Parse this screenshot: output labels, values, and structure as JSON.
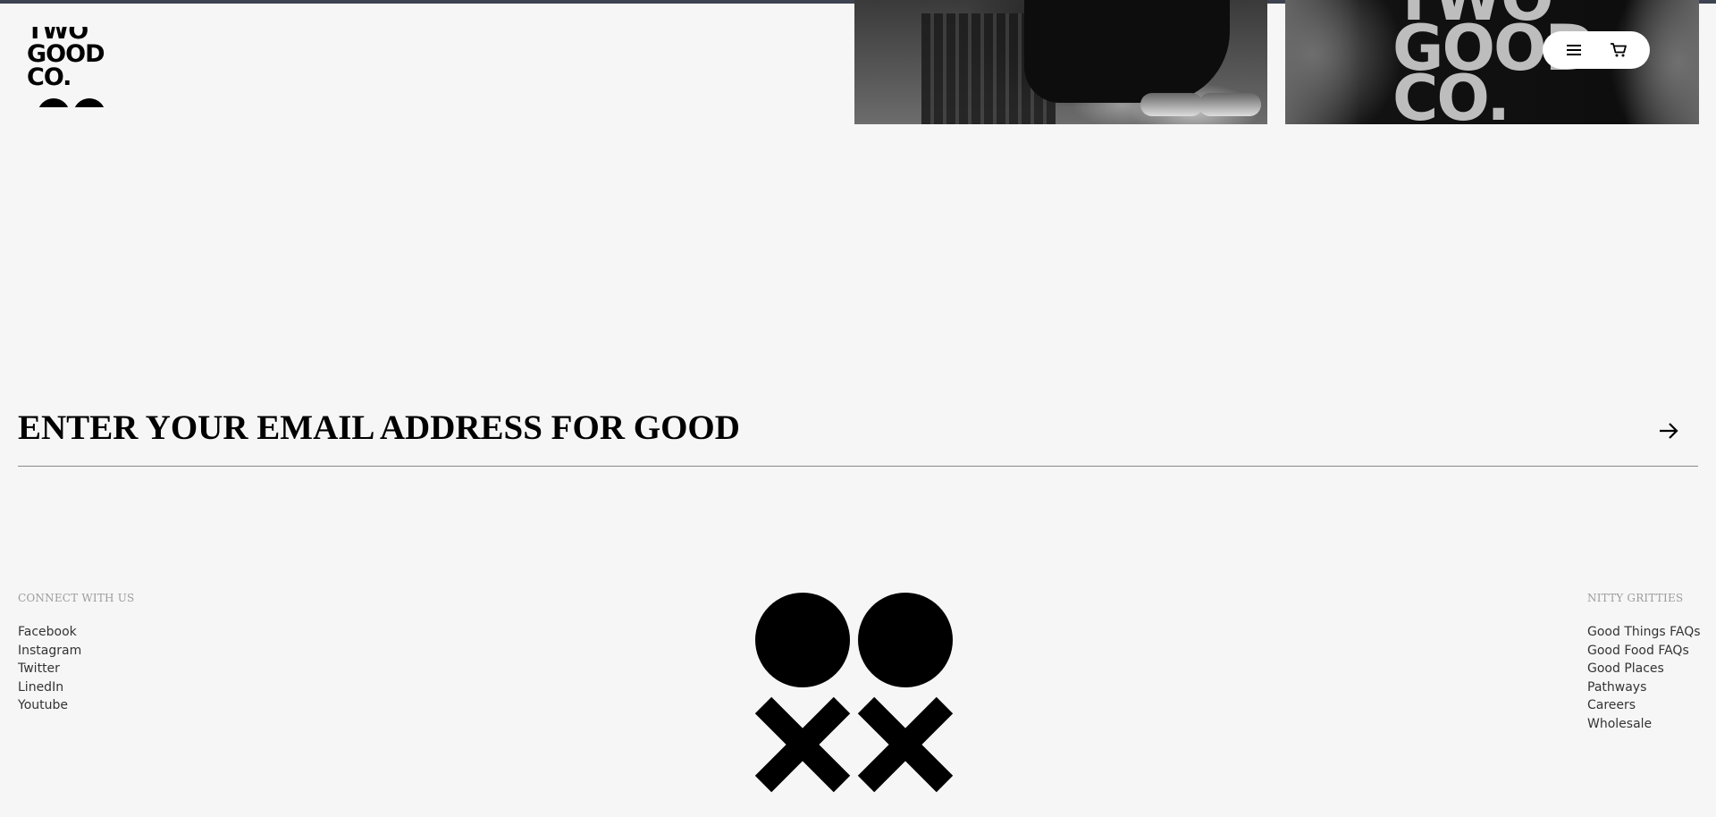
{
  "logo": {
    "line1": "TWO",
    "line2": "GOOD",
    "line3": "CO."
  },
  "header": {
    "menu_icon": "hamburger-menu-icon",
    "cart_icon": "shopping-cart-icon"
  },
  "photos": {
    "shirt_text_line1": "TWO",
    "shirt_text_line2": "GOOD",
    "shirt_text_line3": "CO."
  },
  "newsletter": {
    "heading": "ENTER YOUR EMAIL ADDRESS FOR GOOD",
    "submit_icon": "arrow-right-icon"
  },
  "footer": {
    "connect": {
      "heading": "CONNECT WITH US",
      "links": [
        "Facebook",
        "Instagram",
        "Twitter",
        "LinedIn",
        "Youtube"
      ]
    },
    "nitty": {
      "heading": "NITTY GRITTIES",
      "links": [
        "Good Things FAQs",
        "Good Food FAQs",
        "Good Places",
        "Pathways",
        "Careers",
        "Wholesale"
      ]
    },
    "mark_icon": "two-good-dots-and-crosses-mark"
  },
  "colors": {
    "background": "#f6f6f6",
    "text": "#000000",
    "muted": "#9c9c9c",
    "top_rule": "#3d4350"
  }
}
